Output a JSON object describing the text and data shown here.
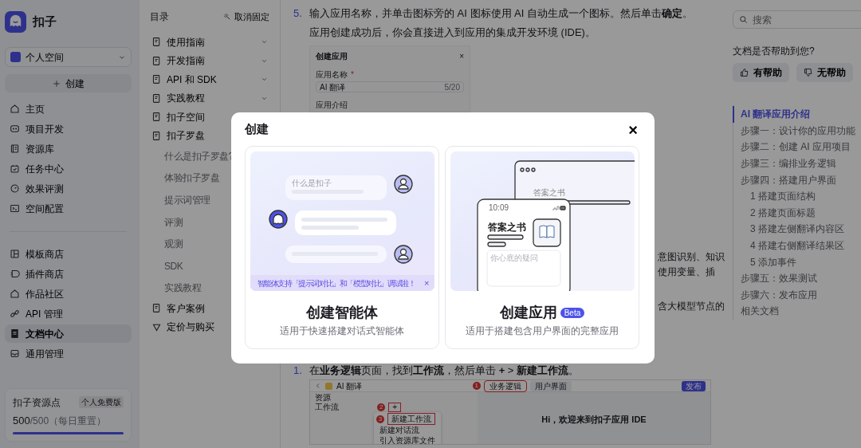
{
  "sidebar": {
    "brand": "扣子",
    "space": "个人空间",
    "create": "创建",
    "nav_primary": [
      {
        "label": "主页",
        "selected": false
      },
      {
        "label": "项目开发",
        "selected": false
      },
      {
        "label": "资源库",
        "selected": false
      },
      {
        "label": "任务中心",
        "selected": false
      },
      {
        "label": "效果评测",
        "selected": false
      },
      {
        "label": "空间配置",
        "selected": false
      }
    ],
    "nav_secondary": [
      {
        "label": "模板商店",
        "selected": false
      },
      {
        "label": "插件商店",
        "selected": false
      },
      {
        "label": "作品社区",
        "selected": false
      },
      {
        "label": "API 管理",
        "selected": false
      },
      {
        "label": "文档中心",
        "selected": true
      },
      {
        "label": "通用管理",
        "selected": false
      }
    ],
    "resource": {
      "title": "扣子资源点",
      "plan": "个人免费版",
      "used": "500",
      "total": "/500",
      "note": "（每日重置）",
      "level": 1.0
    }
  },
  "toc": {
    "title": "目录",
    "unpin": "取消固定",
    "items": [
      {
        "label": "使用指南",
        "expanded": false
      },
      {
        "label": "开发指南",
        "expanded": false
      },
      {
        "label": "API 和 SDK",
        "expanded": false
      },
      {
        "label": "实践教程",
        "expanded": false
      },
      {
        "label": "扣子空间"
      },
      {
        "label": "扣子罗盘",
        "children": [
          {
            "label": "什么是扣子罗盘?"
          },
          {
            "label": "体验扣子罗盘"
          },
          {
            "label": "提示词管理"
          },
          {
            "label": "评测"
          },
          {
            "label": "观测"
          },
          {
            "label": "SDK"
          },
          {
            "label": "实践教程"
          }
        ]
      },
      {
        "label": "客户案例"
      },
      {
        "label": "定价与购买"
      }
    ]
  },
  "content": {
    "step5": {
      "number": "5.",
      "text": "输入应用名称，并单击图标旁的 AI 图标使用 AI 自动生成一个图标。然后单击**确定**。"
    },
    "paragraph": "应用创建成功后，你会直接进入到应用的集成开发环境 (IDE)。",
    "screenshot_dialog": {
      "title": "创建应用",
      "close": "×",
      "name_label": "应用名称",
      "required": "*",
      "name_value": "AI 翻译",
      "counter": "5/20",
      "desc_label": "应用介绍"
    },
    "fragments": [
      "意图识别、知识",
      "使用变量、插",
      "含大模型节点的"
    ],
    "step1": {
      "number": "1.",
      "text": "在**业务逻辑**页面，找到**工作流**，然后单击 **+** > **新建工作流**。"
    },
    "screenshot_ide": {
      "app": "AI 翻译",
      "tabs": [
        "业务逻辑",
        "用户界面"
      ],
      "publish": "发布",
      "panel": "资源",
      "folder": "工作流",
      "add": "+",
      "menu": [
        "新建工作流",
        "新建对话流",
        "引入资源库文件"
      ],
      "welcome": "Hi，欢迎来到扣子应用 IDE",
      "markers": [
        "1",
        "2",
        "3"
      ]
    }
  },
  "right": {
    "search": {
      "placeholder": "搜索"
    },
    "feedback": {
      "question": "文档是否帮助到您?",
      "buttons": [
        "有帮助",
        "无帮助"
      ]
    },
    "outline": [
      {
        "label": "AI 翻译应用介绍",
        "selected": true
      },
      {
        "label": "步骤一：设计你的应用功能",
        "selected": false
      },
      {
        "label": "步骤二：创建 AI 应用项目",
        "selected": false
      },
      {
        "label": "步骤三：编排业务逻辑",
        "selected": false
      },
      {
        "label": "步骤四：搭建用户界面",
        "selected": false,
        "children": [
          {
            "label": "1 搭建页面结构",
            "selected": false
          },
          {
            "label": "2 搭建页面标题",
            "selected": false
          },
          {
            "label": "3 搭建左侧翻译内容区",
            "selected": false
          },
          {
            "label": "4 搭建右侧翻译结果区",
            "selected": false
          },
          {
            "label": "5 添加事件",
            "selected": false
          }
        ]
      },
      {
        "label": "步骤五：效果测试",
        "selected": false
      },
      {
        "label": "步骤六：发布应用",
        "selected": false
      },
      {
        "label": "相关文档",
        "selected": false
      }
    ]
  },
  "modal": {
    "title": "创建",
    "close": "×",
    "cards": [
      {
        "kind": "agent",
        "title": "创建智能体",
        "description": "适用于快速搭建对话式智能体",
        "question": "什么是扣子",
        "banner": "智能体支持「提示词对比」和「模型对比」调试啦！",
        "banner_close": "×"
      },
      {
        "kind": "app",
        "title": "创建应用",
        "badge": "Beta",
        "description": "适用于搭建包含用户界面的完整应用",
        "window_title": "答案之书",
        "app_name": "答案之书",
        "time": "10:09",
        "input_hint": "你心底的疑问"
      }
    ]
  }
}
